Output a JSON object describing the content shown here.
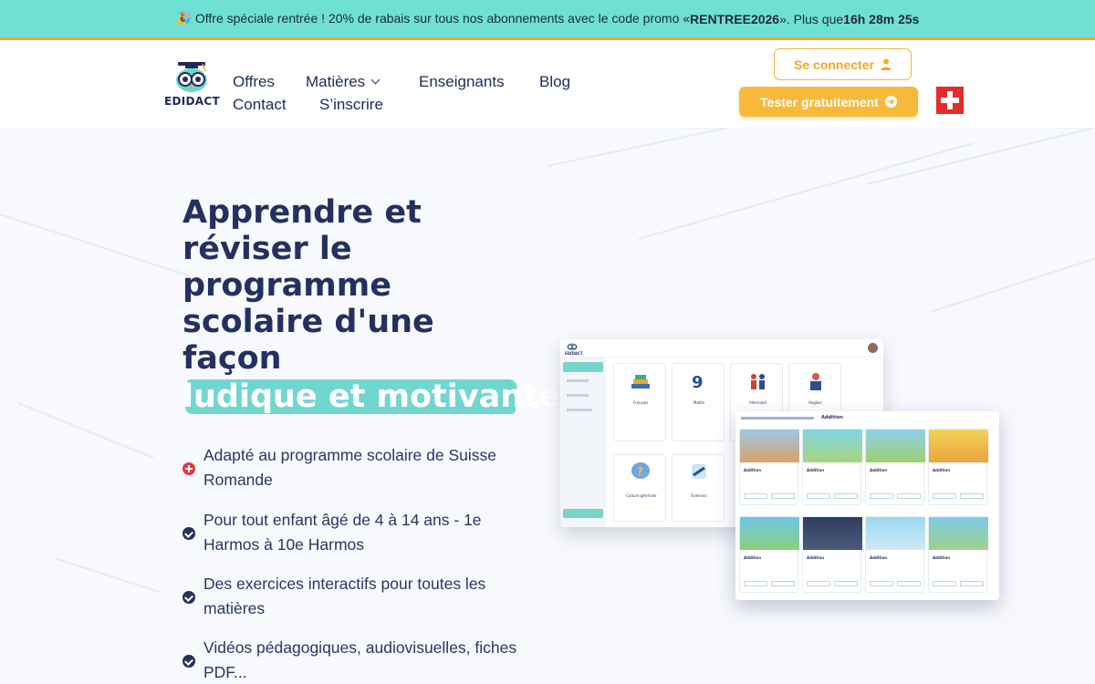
{
  "promo": {
    "text_before": "🎉 Offre spéciale rentrée ! 20% de rabais sur tous nos abonnements avec le code promo « ",
    "code": "RENTREE2026",
    "text_middle": " ». Plus que ",
    "countdown": "16h 28m 25s"
  },
  "header": {
    "logo_text": "EDIDACT",
    "nav": {
      "offres": "Offres",
      "matieres": "Matières",
      "enseignants": "Enseignants",
      "blog": "Blog",
      "contact": "Contact",
      "inscrire": "S’inscrire"
    },
    "login_label": "Se connecter",
    "try_label": "Tester gratuitement",
    "flag_icon": "swiss-flag-icon"
  },
  "hero": {
    "title_lines": [
      "Apprendre et",
      "réviser le",
      "programme",
      "scolaire d'une",
      "façon"
    ],
    "highlight": "ludique et motivante",
    "features": [
      "Adapté au programme scolaire de Suisse Romande",
      "Pour tout enfant âgé de 4 à 14 ans - 1e Harmos à 10e Harmos",
      "Des exercices interactifs pour toutes les matières",
      "Vidéos pédagogiques, audiovisuelles, fiches PDF..."
    ]
  },
  "mockup": {
    "logo_text": "EDIDACT",
    "subjects": [
      "Français",
      "Maths",
      "Allemand",
      "Anglais",
      "Culture générale",
      "Sciences"
    ],
    "card_title": "Addition",
    "breadcrumb": "Addition"
  },
  "colors": {
    "banner": "#6fe0d6",
    "accent": "#f5a623",
    "navy": "#24305f",
    "highlight": "#72d6d0"
  }
}
